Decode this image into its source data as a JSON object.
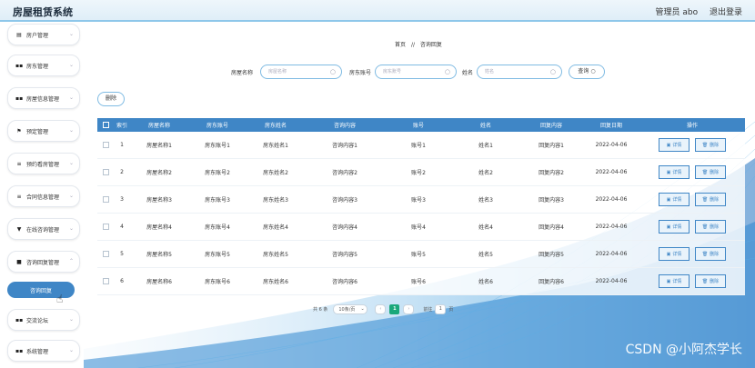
{
  "app": {
    "title": "房屋租赁系统"
  },
  "topbar": {
    "user_label": "管理员 abo",
    "logout": "退出登录"
  },
  "sidebar": {
    "items": [
      {
        "label": "房户管理",
        "icon": "home-icon"
      },
      {
        "label": "房东管理",
        "icon": "grid-icon"
      },
      {
        "label": "房屋信息管理",
        "icon": "grid-icon"
      },
      {
        "label": "预定管理",
        "icon": "flag-icon"
      },
      {
        "label": "预约看房管理",
        "icon": "list-icon"
      },
      {
        "label": "合同信息管理",
        "icon": "list-icon"
      },
      {
        "label": "在线咨询管理",
        "icon": "pin-icon"
      },
      {
        "label": "咨询回复管理",
        "icon": "folder-icon"
      },
      {
        "label": "交流论坛",
        "icon": "grid-icon"
      },
      {
        "label": "系统管理",
        "icon": "grid-icon"
      }
    ],
    "active_sub": "咨询回复"
  },
  "breadcrumb": {
    "home": "首页",
    "sep": "//",
    "current": "咨询回复"
  },
  "search": {
    "fields": [
      {
        "label": "房屋名称",
        "placeholder": "房屋名称"
      },
      {
        "label": "房东账号",
        "placeholder": "房东账号"
      },
      {
        "label": "姓名",
        "placeholder": "姓名"
      }
    ],
    "button": "查询",
    "button_icon": "search-icon"
  },
  "toolbar": {
    "delete_label": "删除"
  },
  "table": {
    "headers": [
      "索引",
      "房屋名称",
      "房东账号",
      "房东姓名",
      "咨询内容",
      "账号",
      "姓名",
      "回复内容",
      "回复日期",
      "操作"
    ],
    "detail_label": "详情",
    "delete_label": "删除",
    "rows": [
      {
        "idx": "1",
        "name": "房屋名称1",
        "acct": "房东账号1",
        "owner": "房东姓名1",
        "q": "咨询内容1",
        "user": "账号1",
        "uname": "姓名1",
        "reply": "回复内容1",
        "date": "2022-04-06"
      },
      {
        "idx": "2",
        "name": "房屋名称2",
        "acct": "房东账号2",
        "owner": "房东姓名2",
        "q": "咨询内容2",
        "user": "账号2",
        "uname": "姓名2",
        "reply": "回复内容2",
        "date": "2022-04-06"
      },
      {
        "idx": "3",
        "name": "房屋名称3",
        "acct": "房东账号3",
        "owner": "房东姓名3",
        "q": "咨询内容3",
        "user": "账号3",
        "uname": "姓名3",
        "reply": "回复内容3",
        "date": "2022-04-06"
      },
      {
        "idx": "4",
        "name": "房屋名称4",
        "acct": "房东账号4",
        "owner": "房东姓名4",
        "q": "咨询内容4",
        "user": "账号4",
        "uname": "姓名4",
        "reply": "回复内容4",
        "date": "2022-04-06"
      },
      {
        "idx": "5",
        "name": "房屋名称5",
        "acct": "房东账号5",
        "owner": "房东姓名5",
        "q": "咨询内容5",
        "user": "账号5",
        "uname": "姓名5",
        "reply": "回复内容5",
        "date": "2022-04-06"
      },
      {
        "idx": "6",
        "name": "房屋名称6",
        "acct": "房东账号6",
        "owner": "房东姓名6",
        "q": "咨询内容6",
        "user": "账号6",
        "uname": "姓名6",
        "reply": "回复内容6",
        "date": "2022-04-06"
      }
    ]
  },
  "pagination": {
    "total": "共 6 条",
    "page_size": "10条/页",
    "current": "1",
    "goto_prefix": "前往",
    "goto_value": "1",
    "goto_suffix": "页"
  },
  "watermark": "CSDN @小阿杰学长",
  "colors": {
    "primary": "#3f86c6",
    "accent_green": "#1aa87a",
    "border": "#7fbbe3"
  }
}
